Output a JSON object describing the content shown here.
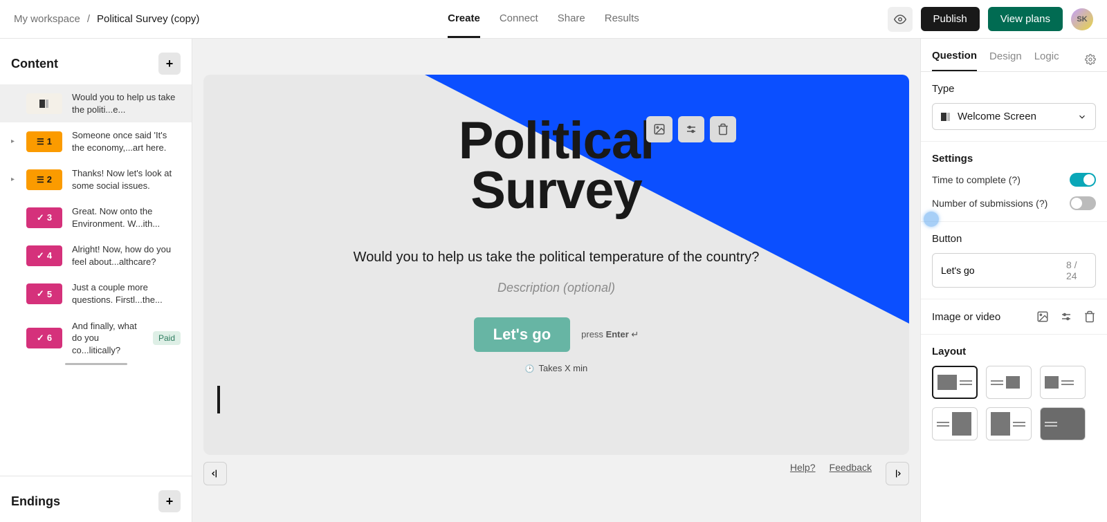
{
  "breadcrumb": {
    "root": "My workspace",
    "sep": "/",
    "current": "Political Survey (copy)"
  },
  "header_tabs": {
    "create": "Create",
    "connect": "Connect",
    "share": "Share",
    "results": "Results"
  },
  "header_actions": {
    "publish": "Publish",
    "plans": "View plans",
    "avatar": "SK"
  },
  "left": {
    "content": "Content",
    "endings": "Endings",
    "items": [
      {
        "label": "Would you to help us take the politi...e..."
      },
      {
        "num": "1",
        "label": "Someone once said 'It's the economy,...art here."
      },
      {
        "num": "2",
        "label": "Thanks! Now let's look at some social issues."
      },
      {
        "num": "3",
        "label": "Great. Now onto the Environment. W...ith..."
      },
      {
        "num": "4",
        "label": "Alright! Now, how do you feel about...althcare?"
      },
      {
        "num": "5",
        "label": "Just a couple more questions. Firstl...the..."
      },
      {
        "num": "6",
        "label": "And finally, what do you co...litically?"
      }
    ],
    "paid": "Paid"
  },
  "canvas": {
    "title1": "Political",
    "title2": "Survey",
    "question": "Would you to help us take the political temperature of the country?",
    "desc": "Description (optional)",
    "cta": "Let's go",
    "hint_press": "press",
    "hint_enter": "Enter",
    "hint_sym": "↵",
    "time": "Takes X min"
  },
  "footer": {
    "help": "Help?",
    "feedback": "Feedback"
  },
  "right": {
    "tabs": {
      "q": "Question",
      "d": "Design",
      "l": "Logic"
    },
    "type_label": "Type",
    "type_value": "Welcome Screen",
    "settings": "Settings",
    "setting_time": "Time to complete (?)",
    "setting_subs": "Number of submissions (?)",
    "button_label": "Button",
    "button_value": "Let's go",
    "button_count": "8 / 24",
    "media_label": "Image or video",
    "layout_label": "Layout"
  }
}
